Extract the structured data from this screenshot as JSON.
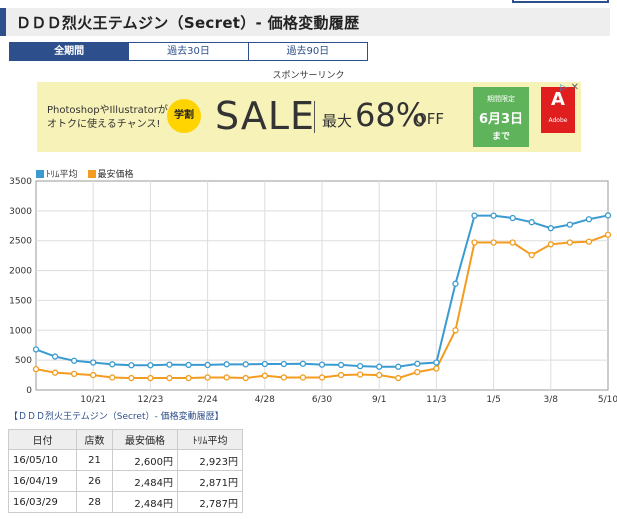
{
  "page_title": "ＤＤＤ烈火王テムジン（Secret）- 価格変動履歴",
  "tabs": [
    {
      "label": "全期間",
      "active": true
    },
    {
      "label": "過去30日",
      "active": false
    },
    {
      "label": "過去90日",
      "active": false
    }
  ],
  "sponsor_label": "スポンサーリンク",
  "ad": {
    "text_line1": "PhotoshopやIllustratorが",
    "text_line2": "オトクに使えるチャンス!",
    "badge": "学割",
    "sale": "SALE",
    "max": "最大",
    "percent": "68%",
    "off": "OFF",
    "limited": "期間限定",
    "date": "6月3日",
    "until": "まで",
    "brand_mark": "A",
    "brand_name": "Adobe",
    "info_icon": "info-icon",
    "close_icon": "close-icon",
    "colors": {
      "bg": "#f7f2b8",
      "green": "#5fb35a",
      "red": "#e01e1e",
      "badge": "#ffd400"
    }
  },
  "chart_data": {
    "type": "line",
    "x_tick_labels": [
      "10/21",
      "12/23",
      "2/24",
      "4/28",
      "6/30",
      "9/1",
      "11/3",
      "1/5",
      "3/8",
      "5/10"
    ],
    "ylim": [
      0,
      3500
    ],
    "y_ticks": [
      0,
      500,
      1000,
      1500,
      2000,
      2500,
      3000,
      3500
    ],
    "grid": true,
    "legend_position": "top-left",
    "series": [
      {
        "name": "ﾄﾘﾑ平均",
        "color": "#3a9bd0",
        "values": [
          680,
          560,
          490,
          460,
          430,
          415,
          415,
          425,
          420,
          420,
          430,
          430,
          435,
          435,
          440,
          425,
          420,
          400,
          390,
          390,
          440,
          460,
          1780,
          2920,
          2920,
          2880,
          2810,
          2710,
          2770,
          2860,
          2923
        ]
      },
      {
        "name": "最安価格",
        "color": "#f39c1f",
        "values": [
          350,
          290,
          270,
          250,
          210,
          200,
          200,
          200,
          200,
          210,
          210,
          200,
          240,
          210,
          210,
          210,
          250,
          260,
          250,
          200,
          300,
          360,
          1000,
          2470,
          2470,
          2470,
          2260,
          2440,
          2470,
          2484,
          2600
        ]
      }
    ]
  },
  "table_caption": "【ＤＤＤ烈火王テムジン（Secret）- 価格変動履歴】",
  "table": {
    "headers": [
      "日付",
      "店数",
      "最安価格",
      "ﾄﾘﾑ平均"
    ],
    "rows": [
      [
        "16/05/10",
        "21",
        "2,600円",
        "2,923円"
      ],
      [
        "16/04/19",
        "26",
        "2,484円",
        "2,871円"
      ],
      [
        "16/03/29",
        "28",
        "2,484円",
        "2,787円"
      ]
    ]
  }
}
